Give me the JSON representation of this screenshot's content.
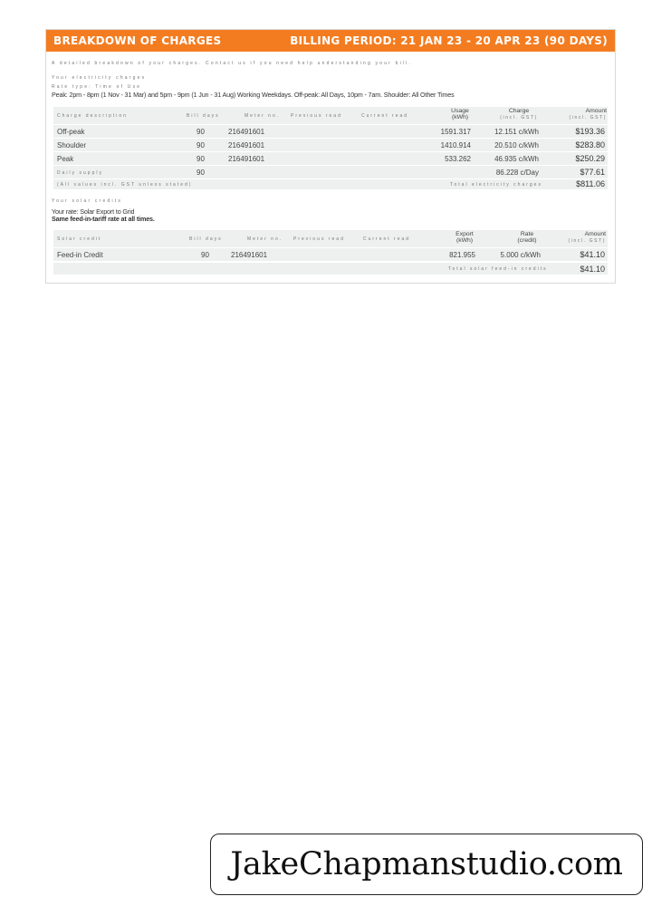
{
  "header": {
    "title": "BREAKDOWN OF CHARGES",
    "billing_period": "BILLING PERIOD: 21 JAN 23 - 20 APR 23 (90 DAYS)"
  },
  "intro": {
    "line1": "A detailed breakdown of your charges. Contact us if you need help understanding your bill.",
    "section_title": "Your electricity charges",
    "tariff_line": "Rate type: Time of Use",
    "times_line": "Peak: 2pm - 8pm (1 Nov - 31 Mar) and 5pm - 9pm (1 Jun - 31 Aug) Working Weekdays. Off-peak: All Days, 10pm - 7am. Shoulder: All Other Times"
  },
  "charges_table": {
    "headers": {
      "description": "Charge description",
      "days": "Bill days",
      "meter": "Meter no.",
      "previous": "Previous read",
      "current": "Current read",
      "usage": "Usage",
      "usage_unit": "(kWh)",
      "charge": "Charge",
      "charge_sub": "(incl. GST)",
      "amount": "Amount",
      "amount_sub": "(incl. GST)"
    },
    "rows": [
      {
        "desc": "Off-peak",
        "days": "90",
        "meter": "216491601",
        "usage": "1591.317",
        "rate": "12.151 c/kWh",
        "amount": "$193.36"
      },
      {
        "desc": "Shoulder",
        "days": "90",
        "meter": "216491601",
        "usage": "1410.914",
        "rate": "20.510 c/kWh",
        "amount": "$283.80"
      },
      {
        "desc": "Peak",
        "days": "90",
        "meter": "216491601",
        "usage": "533.262",
        "rate": "46.935 c/kWh",
        "amount": "$250.29"
      },
      {
        "desc": "Daily supply",
        "days": "90",
        "meter": "",
        "usage": "",
        "rate": "86.228 c/Day",
        "amount": "$77.61"
      }
    ],
    "total_note": "(All values incl. GST unless stated)",
    "total_label": "Total electricity charges",
    "total_amount": "$811.06"
  },
  "solar": {
    "section_title": "Your solar credits",
    "rate_line": "Your rate: Solar Export to Grid",
    "note_line": "Same feed-in-tariff rate at all times.",
    "headers": {
      "credit": "Solar credit",
      "days": "Bill days",
      "meter": "Meter no.",
      "previous": "Previous read",
      "current": "Current read",
      "export": "Export",
      "export_unit": "(kWh)",
      "rate": "Rate",
      "rate_sub": "(credit)",
      "amount": "Amount",
      "amount_sub": "(incl. GST)"
    },
    "row": {
      "desc": "Feed-in Credit",
      "days": "90",
      "meter": "216491601",
      "export": "821.955",
      "rate": "5.000 c/kWh",
      "amount": "$41.10"
    },
    "total_label": "Total solar feed-in credits",
    "total_amount": "$41.10"
  },
  "watermark": {
    "text": "JakeChapmanstudio.com"
  },
  "colors": {
    "header_bg": "#f47c20",
    "row_bg": "#eef0f0"
  }
}
